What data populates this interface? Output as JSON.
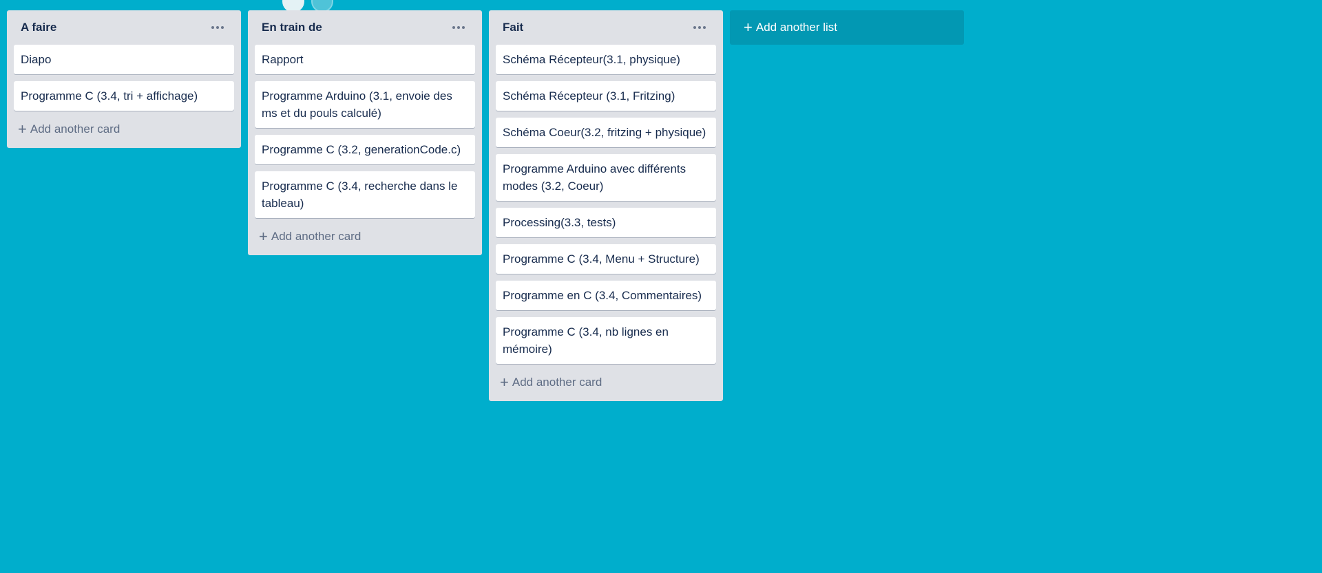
{
  "board": {
    "background_color": "#00aecc",
    "lists": [
      {
        "title": "A faire",
        "cards": [
          "Diapo",
          "Programme C (3.4, tri + affichage)"
        ],
        "add_card_label": "Add another card"
      },
      {
        "title": "En train de",
        "cards": [
          "Rapport",
          "Programme Arduino (3.1, envoie des ms et du pouls calculé)",
          "Programme C (3.2, generationCode.c)",
          "Programme C (3.4, recherche dans le tableau)"
        ],
        "add_card_label": "Add another card"
      },
      {
        "title": "Fait",
        "cards": [
          "Schéma Récepteur(3.1, physique)",
          "Schéma Récepteur (3.1, Fritzing)",
          "Schéma Coeur(3.2, fritzing + physique)",
          "Programme Arduino avec différents modes (3.2, Coeur)",
          "Processing(3.3, tests)",
          "Programme C (3.4, Menu + Structure)",
          "Programme en C (3.4, Commentaires)",
          "Programme C (3.4, nb lignes en mémoire)"
        ],
        "add_card_label": "Add another card"
      }
    ],
    "add_list_label": "Add another list",
    "icons": {
      "list_menu": "more-horizontal-icon",
      "add": "plus-icon"
    }
  }
}
